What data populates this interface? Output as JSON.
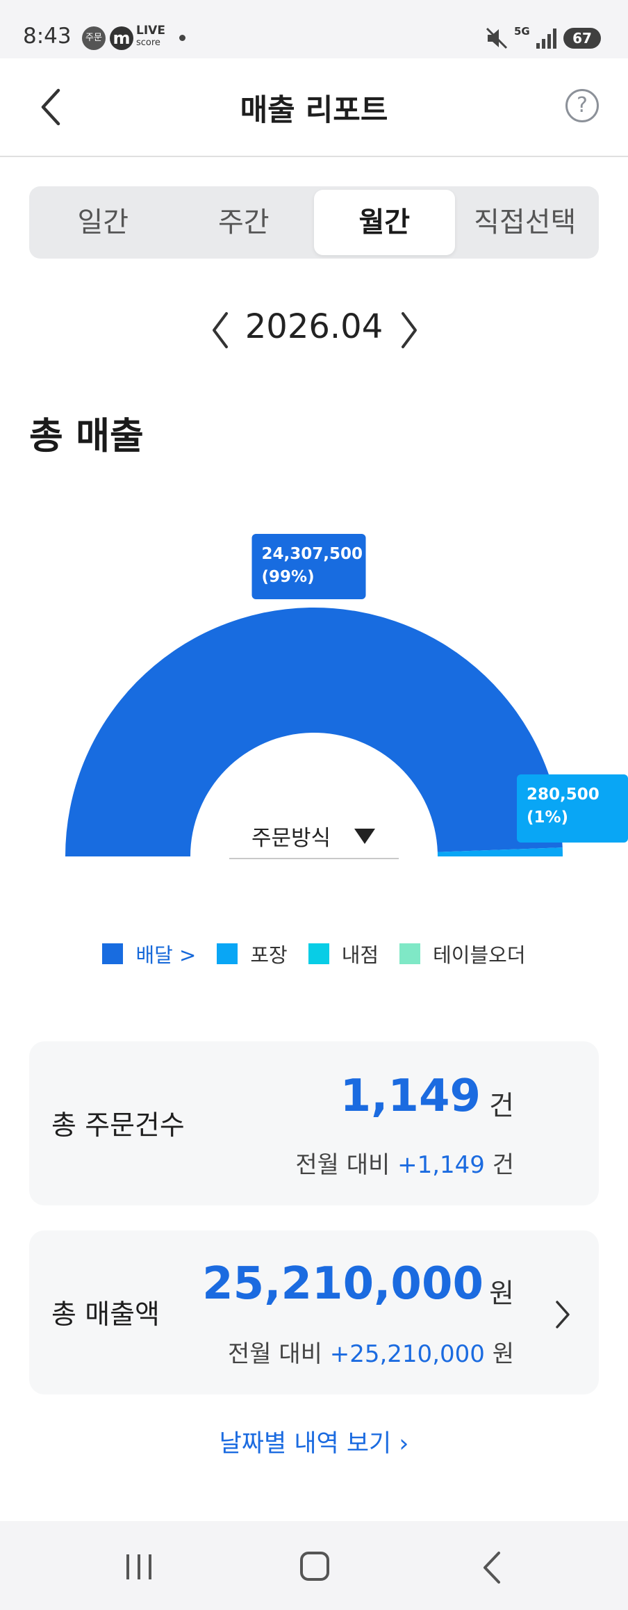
{
  "status_bar": {
    "time": "8:43",
    "notif1": "주문",
    "notif2": "m",
    "notif3_top": "LIVE",
    "notif3_bottom": "score",
    "network": "5G",
    "battery": "67"
  },
  "header": {
    "title": "매출 리포트",
    "back_icon": "chevron-left-icon",
    "help_icon": "question-circle-icon",
    "help_glyph": "?"
  },
  "tabs": [
    {
      "label": "일간",
      "active": false
    },
    {
      "label": "주간",
      "active": false
    },
    {
      "label": "월간",
      "active": true
    },
    {
      "label": "직접선택",
      "active": false
    }
  ],
  "period": {
    "label": "2026.04"
  },
  "section_title": "총 매출",
  "chart_data": {
    "type": "donut-half",
    "series": [
      {
        "name": "배달",
        "value": 24307500,
        "percent": 99,
        "color": "#186ce0"
      },
      {
        "name": "포장",
        "value": 280500,
        "percent": 1,
        "color": "#09a6f5"
      },
      {
        "name": "내점",
        "value": 0,
        "percent": 0,
        "color": "#08cde6"
      },
      {
        "name": "테이블오더",
        "value": 0,
        "percent": 0,
        "color": "#7fe8c6"
      }
    ],
    "labels": [
      {
        "line1": "24,307,500",
        "line2": "(99%)"
      },
      {
        "line1": "280,500",
        "line2": "(1%)"
      }
    ]
  },
  "dropdown": {
    "label": "주문방식"
  },
  "legend": [
    {
      "label": "배달 >",
      "color": "#186ce0",
      "link": true
    },
    {
      "label": "포장",
      "color": "#09a6f5",
      "link": false
    },
    {
      "label": "내점",
      "color": "#08cde6",
      "link": false
    },
    {
      "label": "테이블오더",
      "color": "#7fe8c6",
      "link": false
    }
  ],
  "orders_card": {
    "label": "총 주문건수",
    "value": "1,149",
    "unit": "건",
    "compare_prefix": "전월 대비 ",
    "compare_value": "+1,149",
    "compare_unit": " 건"
  },
  "sales_card": {
    "label": "총 매출액",
    "value": "25,210,000",
    "unit": "원",
    "compare_prefix": "전월 대비 ",
    "compare_value": "+25,210,000",
    "compare_unit": " 원"
  },
  "daily_link": "날짜별 내역 보기 ›"
}
